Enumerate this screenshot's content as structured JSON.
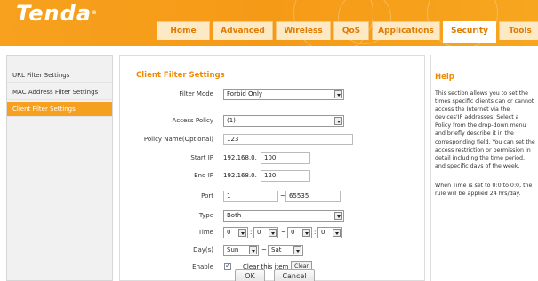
{
  "header": {
    "logo": "Tenda",
    "logo_mark": "®",
    "tabs": [
      {
        "label": "Home"
      },
      {
        "label": "Advanced"
      },
      {
        "label": "Wireless"
      },
      {
        "label": "QoS"
      },
      {
        "label": "Applications"
      },
      {
        "label": "Security",
        "active": true
      },
      {
        "label": "Tools"
      }
    ]
  },
  "sidebar": {
    "items": [
      {
        "label": "URL Filter Settings"
      },
      {
        "label": "MAC Address Filter Settings"
      },
      {
        "label": "Client Filter Settings",
        "active": true
      }
    ]
  },
  "main": {
    "title": "Client Filter Settings",
    "filter_mode": {
      "label": "Filter Mode",
      "value": "Forbid Only"
    },
    "access_policy": {
      "label": "Access Policy",
      "value": "(1)"
    },
    "policy_name": {
      "label": "Policy Name(Optional)",
      "value": "123"
    },
    "start_ip": {
      "label": "Start IP",
      "prefix": "192.168.0.",
      "value": "100"
    },
    "end_ip": {
      "label": "End IP",
      "prefix": "192.168.0.",
      "value": "120"
    },
    "port": {
      "label": "Port",
      "from": "1",
      "separator": "~",
      "to": "65535"
    },
    "type": {
      "label": "Type",
      "value": "Both"
    },
    "time": {
      "label": "Time",
      "start_hour": "0",
      "start_min": "0",
      "separator": "~",
      "end_hour": "0",
      "end_min": "0",
      "colon": ":"
    },
    "days": {
      "label": "Day(s)",
      "from": "Sun",
      "separator": "~",
      "to": "Sat"
    },
    "enable": {
      "label": "Enable",
      "checked": true,
      "clear_text": "Clear this item",
      "clear_button": "Clear"
    },
    "ok_button": "OK",
    "cancel_button": "Cancel"
  },
  "help": {
    "title": "Help",
    "paragraph1": "This section allows you to set the times specific clients can or cannot access the Internet via the devices'IP addresses. Select a Policy from the drop-down menu and briefly describe it in the corresponding field. You can set the access restriction or permission in detail including the time period, and specific days of the week.",
    "paragraph2": "When Time is set to 0:0 to 0:0, the rule will be applied 24 hrs/day."
  },
  "colors": {
    "brand_orange": "#f5a01f",
    "title_orange": "#f08a00"
  }
}
